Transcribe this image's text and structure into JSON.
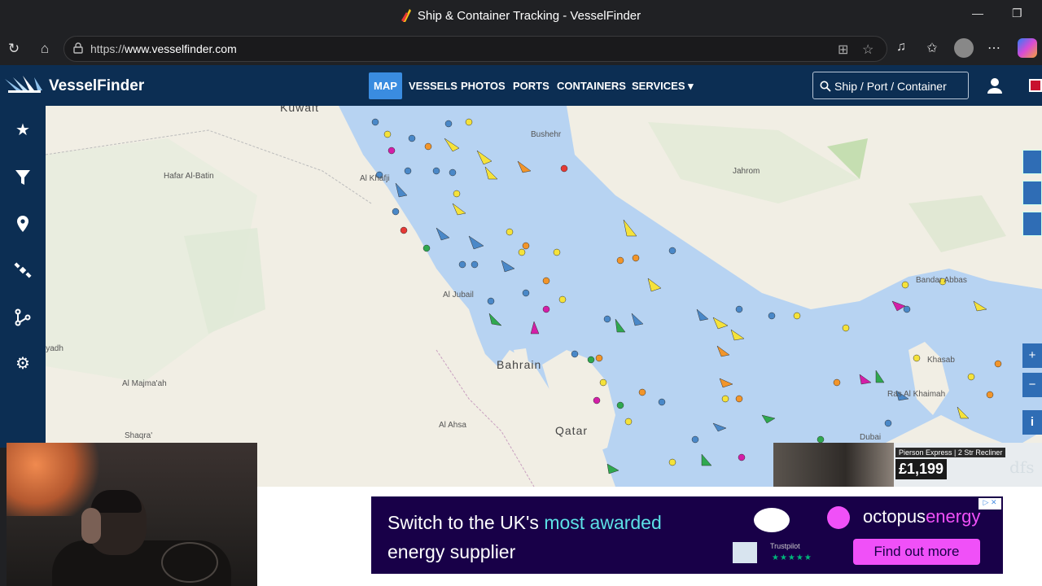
{
  "browser": {
    "title": "Ship & Container Tracking - VesselFinder",
    "url_prefix": "https://",
    "url_host": "www.vesselfinder.com"
  },
  "header": {
    "logo": "VesselFinder",
    "nav": [
      "MAP",
      "VESSELS",
      "PHOTOS",
      "PORTS",
      "CONTAINERS",
      "SERVICES"
    ],
    "search_label": "Ship / Port / Container"
  },
  "map": {
    "labels": {
      "kuwait": "Kuwait",
      "bushehr": "Bushehr",
      "hafar": "Hafar Al-Batin",
      "khafji": "Al Khafji",
      "jahrom": "Jahrom",
      "bandar": "Bandar Abbas",
      "jubail": "Al Jubail",
      "bahrain": "Bahrain",
      "khasab": "Khasab",
      "riyadh": "iyadh",
      "majmaah": "Al Majma'ah",
      "raskhaimah": "Ras Al Khaimah",
      "ahsa": "Al Ahsa",
      "qatar": "Qatar",
      "shaqra": "Shaqra'",
      "dubai": "Dubai"
    },
    "zoom_in": "+",
    "zoom_out": "−",
    "info": "i"
  },
  "ads": {
    "dfs_tag": "Pierson Express | 2 Str Recliner",
    "dfs_price": "£1,199",
    "dfs_brand": "dfs",
    "octo_line1": "Switch to the UK's ",
    "octo_highlight": "most awarded",
    "octo_line2": "energy supplier",
    "octo_brand_a": "octopus",
    "octo_brand_b": "energy",
    "octo_cta": "Find out more",
    "trustpilot": "Trustpilot",
    "stars": "★★★★★"
  }
}
